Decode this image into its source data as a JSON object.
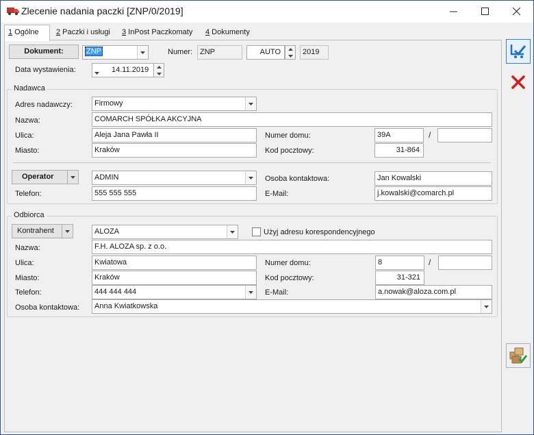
{
  "window": {
    "title": "Zlecenie nadania paczki [ZNP/0/2019]",
    "minimize_label": "—",
    "maximize_label": "☐",
    "close_label": "✕"
  },
  "tabs": [
    {
      "hotkey": "1",
      "label": " Ogólne"
    },
    {
      "hotkey": "2",
      "label": " Paczki i usługi"
    },
    {
      "hotkey": "3",
      "label": " InPost Paczkomaty"
    },
    {
      "hotkey": "4",
      "label": " Dokumenty"
    }
  ],
  "header": {
    "dokument_button": "Dokument:",
    "dokument_value": "ZNP",
    "numer_label": "Numer:",
    "numer_prefix": "ZNP",
    "numer_auto": "AUTO",
    "numer_year": "2019",
    "data_label": "Data wystawienia:",
    "data_value": "14.11.2019"
  },
  "nadawca": {
    "title": "Nadawca",
    "adres_label": "Adres nadawczy:",
    "adres_value": "Firmowy",
    "nazwa_label": "Nazwa:",
    "nazwa_value": "COMARCH SPÓŁKA AKCYJNA",
    "ulica_label": "Ulica:",
    "ulica_value": "Aleja Jana Pawła II",
    "numer_domu_label": "Numer domu:",
    "numer_domu_value": "39A",
    "numer_lokalu_value": "",
    "slash": "/",
    "miasto_label": "Miasto:",
    "miasto_value": "Kraków",
    "kod_label": "Kod pocztowy:",
    "kod_value": "31-864",
    "operator_button": "Operator",
    "operator_value": "ADMIN",
    "osoba_label": "Osoba kontaktowa:",
    "osoba_value": "Jan Kowalski",
    "telefon_label": "Telefon:",
    "telefon_value": "555 555 555",
    "email_label": "E-Mail:",
    "email_value": "j.kowalski@comarch.pl"
  },
  "odbiorca": {
    "title": "Odbiorca",
    "kontrahent_button": "Kontrahent",
    "kontrahent_value": "ALOZA",
    "checkbox_label": "Użyj adresu korespondencyjnego",
    "checkbox_checked": false,
    "nazwa_label": "Nazwa:",
    "nazwa_value": "F.H. ALOZA sp. z o.o.",
    "ulica_label": "Ulica:",
    "ulica_value": "Kwiatowa",
    "numer_domu_label": "Numer domu:",
    "numer_domu_value": "8",
    "numer_lokalu_value": "",
    "slash": "/",
    "miasto_label": "Miasto:",
    "miasto_value": "Kraków",
    "kod_label": "Kod pocztowy:",
    "kod_value": "31-321",
    "telefon_label": "Telefon:",
    "telefon_value": "444 444 444",
    "email_label": "E-Mail:",
    "email_value": "a.nowak@aloza.com.pl",
    "osoba_label": "Osoba kontaktowa:",
    "osoba_value": "Anna Kwiatkowska"
  },
  "colors": {
    "accent": "#3399ff",
    "save_blue": "#1f6fd1",
    "cancel_red": "#d7191c",
    "title_icon": "#c0392b"
  },
  "icons": {
    "save": "save-icon",
    "cancel": "cancel-icon",
    "send_package": "package-check-icon",
    "app": "truck-icon"
  }
}
